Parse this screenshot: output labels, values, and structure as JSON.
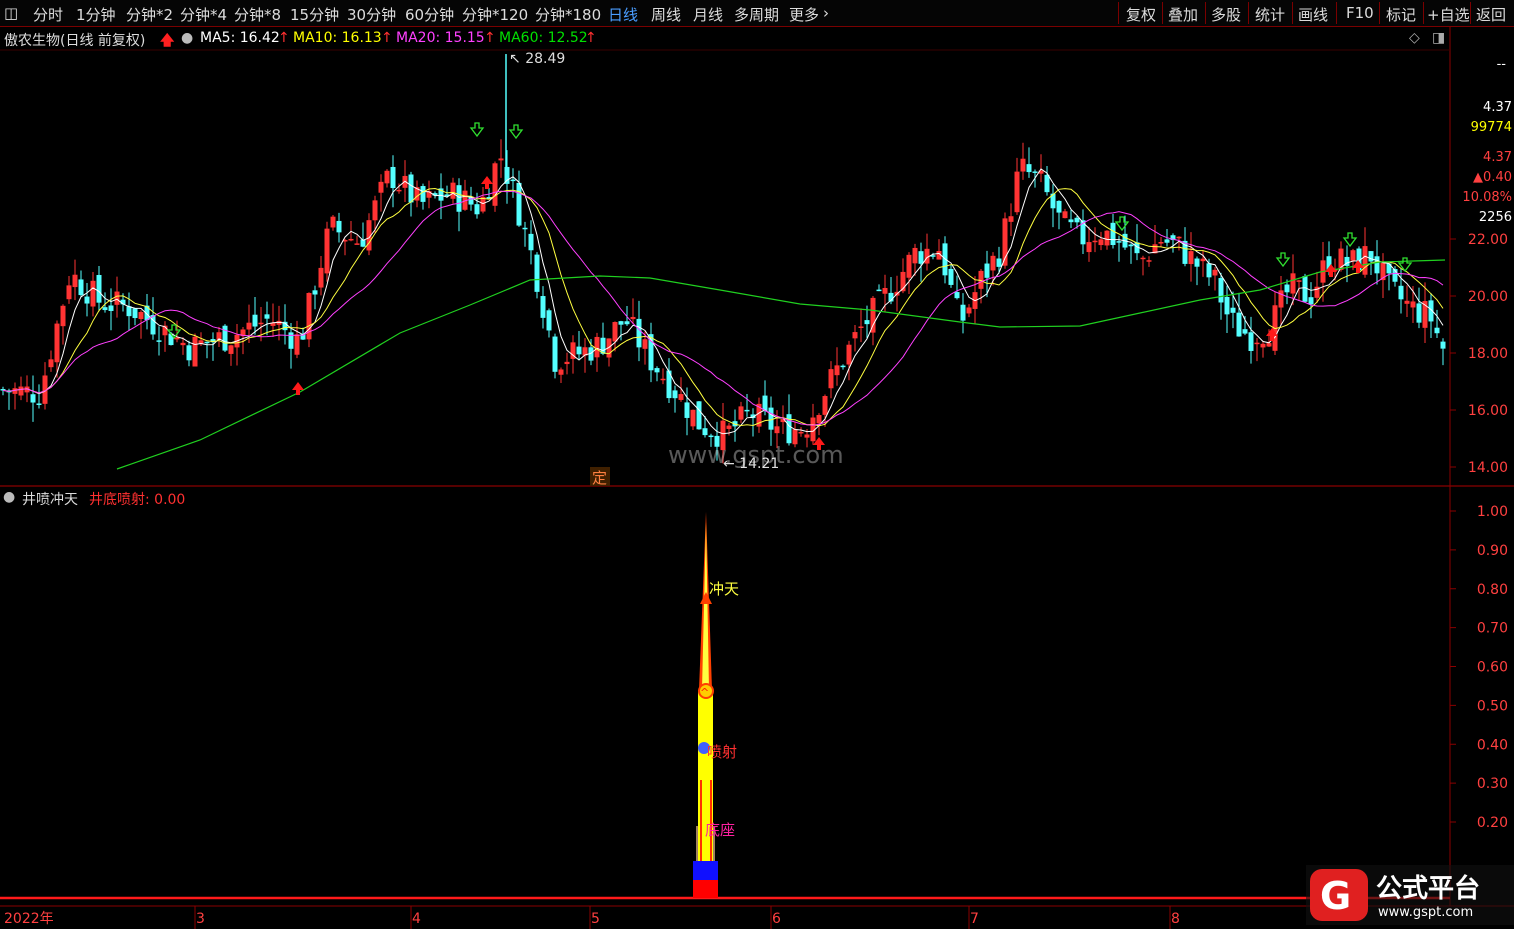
{
  "toolbar": {
    "left_items": [
      "分时",
      "1分钟",
      "分钟*2",
      "分钟*4",
      "分钟*8",
      "15分钟",
      "30分钟",
      "60分钟",
      "分钟*120",
      "分钟*180",
      "日线",
      "周线",
      "月线",
      "多周期",
      "更多"
    ],
    "active_item": "日线",
    "right_items": [
      "复权",
      "叠加",
      "多股",
      "统计",
      "画线",
      "F10",
      "标记",
      "+自选",
      "返回"
    ]
  },
  "stock": {
    "title": "傲农生物(日线 前复权)",
    "ma": [
      {
        "label": "MA5: 16.42",
        "color": "#ffffff"
      },
      {
        "label": "MA10: 16.13",
        "color": "#ffff00"
      },
      {
        "label": "MA20: 15.15",
        "color": "#ff40ff"
      },
      {
        "label": "MA60: 12.52",
        "color": "#00e000"
      }
    ],
    "high_label": "28.49",
    "low_label": "14.21",
    "watermark": "www.gspt.com",
    "marker": "定"
  },
  "price_axis": {
    "ticks": [
      "22.00",
      "20.00",
      "18.00",
      "16.00",
      "14.00"
    ],
    "side_info": [
      "--",
      "4.37",
      "99774",
      "4.37",
      "▲0.40",
      "10.08%",
      "2256"
    ]
  },
  "indicator": {
    "name": "井喷冲天",
    "label": "井底喷射: 0.00",
    "ticks": [
      "1.00",
      "0.90",
      "0.80",
      "0.70",
      "0.60",
      "0.50",
      "0.40",
      "0.30",
      "0.20"
    ],
    "annotations": [
      "冲天",
      "喷射",
      "底座"
    ]
  },
  "time_axis": [
    "2022年",
    "3",
    "4",
    "5",
    "6",
    "7",
    "8"
  ],
  "logo": {
    "name": "公式平台",
    "url": "www.gspt.com"
  }
}
